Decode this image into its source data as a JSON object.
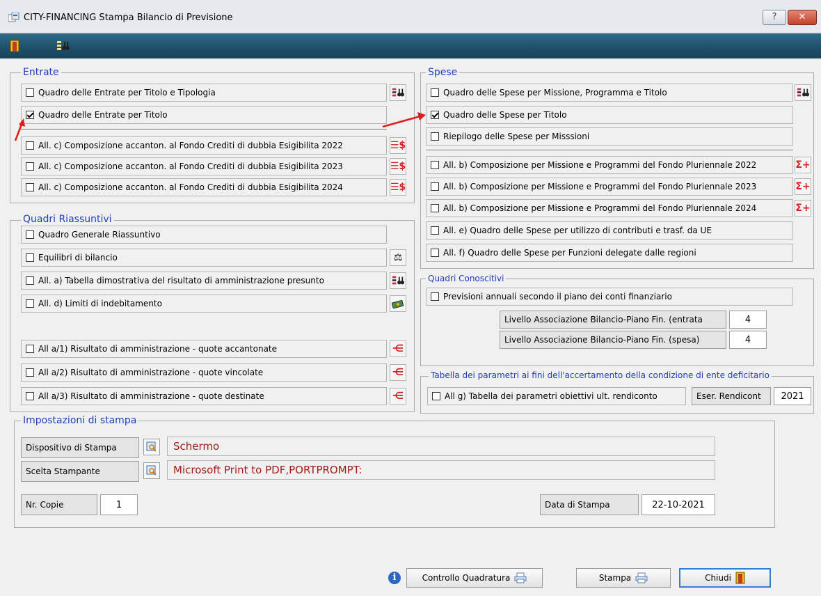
{
  "window": {
    "title": "CITY-FINANCING  Stampa Bilancio di Previsione",
    "help_label": "?",
    "close_label": "✕"
  },
  "entrate": {
    "legend": "Entrate",
    "rows": [
      {
        "label": "Quadro delle Entrate per Titolo e Tipologia",
        "checked": false
      },
      {
        "label": "Quadro delle Entrate per Titolo",
        "checked": true
      },
      {
        "label": "All. c) Composizione accanton. al Fondo Crediti di dubbia Esigibilita 2022",
        "checked": false
      },
      {
        "label": "All. c) Composizione accanton. al Fondo Crediti di dubbia Esigibilita 2023",
        "checked": false
      },
      {
        "label": "All. c) Composizione accanton. al Fondo Crediti di dubbia Esigibilita 2024",
        "checked": false
      }
    ]
  },
  "riassuntivi": {
    "legend": "Quadri Riassuntivi",
    "rows": [
      {
        "label": "Quadro Generale Riassuntivo",
        "checked": false
      },
      {
        "label": "Equilibri di bilancio",
        "checked": false
      },
      {
        "label": "All. a) Tabella dimostrativa del risultato di amministrazione presunto",
        "checked": false
      },
      {
        "label": "All. d) Limiti di indebitamento",
        "checked": false
      },
      {
        "label": "All a/1)  Risultato di amministrazione - quote accantonate",
        "checked": false
      },
      {
        "label": "All a/2)  Risultato di amministrazione - quote vincolate",
        "checked": false
      },
      {
        "label": "All a/3)  Risultato di amministrazione - quote destinate",
        "checked": false
      }
    ]
  },
  "spese": {
    "legend": "Spese",
    "rows": [
      {
        "label": "Quadro delle  Spese per Missione, Programma e Titolo",
        "checked": false
      },
      {
        "label": "Quadro delle Spese per Titolo",
        "checked": true
      },
      {
        "label": "Riepilogo delle Spese per Misssioni",
        "checked": false
      },
      {
        "label": "All. b) Composizione per Missione e Programmi del Fondo Pluriennale 2022",
        "checked": false
      },
      {
        "label": "All. b) Composizione per Missione e Programmi del Fondo Pluriennale 2023",
        "checked": false
      },
      {
        "label": "All. b) Composizione per Missione e Programmi del Fondo Pluriennale 2024",
        "checked": false
      },
      {
        "label": "All. e) Quadro delle  Spese per utilizzo di contributi e trasf. da UE",
        "checked": false
      },
      {
        "label": "All. f) Quadro delle  Spese per Funzioni delegate dalle regioni",
        "checked": false
      }
    ]
  },
  "conoscitivi": {
    "legend": "Quadri Conoscitivi",
    "row": {
      "label": "Previsioni annuali secondo il piano dei conti finanziario",
      "checked": false
    },
    "livello_entrata_label": "Livello Associazione Bilancio-Piano Fin. (entrata",
    "livello_entrata_value": "4",
    "livello_spesa_label": "Livello Associazione Bilancio-Piano Fin. (spesa)",
    "livello_spesa_value": "4"
  },
  "parametri": {
    "legend": "Tabella dei parametri ai fini dell'accertamento della condizione di ente deficitario",
    "row": {
      "label": "All g) Tabella dei parametri obiettivi ult. rendiconto",
      "checked": false
    },
    "eser_label": "Eser. Rendicont",
    "eser_value": "2021"
  },
  "stampa": {
    "legend": "Impostazioni di stampa",
    "dispositivo_label": "Dispositivo di Stampa",
    "dispositivo_value": "Schermo",
    "stampante_label": "Scelta Stampante",
    "stampante_value": "Microsoft Print to PDF,PORTPROMPT:",
    "copie_label": "Nr. Copie",
    "copie_value": "1",
    "data_label": "Data di Stampa",
    "data_value": "22-10-2021"
  },
  "buttons": {
    "info_label": "i",
    "controllo_label": "Controllo Quadratura",
    "stampa_label": "Stampa",
    "chiudi_label": "Chiudi"
  },
  "colors": {
    "legend_blue": "#1f3eb8",
    "field_red": "#9b1c12",
    "toolbar_teal": "#1e4e68"
  }
}
